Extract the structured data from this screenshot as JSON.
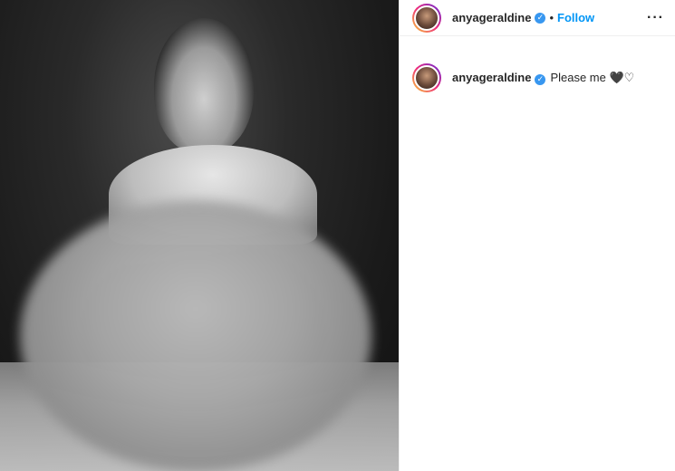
{
  "post": {
    "username": "anyageraldine",
    "follow_label": "Follow",
    "separator": "•",
    "more_label": "···",
    "verified_glyph": "✓",
    "caption": "Please me 🖤♡"
  },
  "icons": {
    "verified": "verified-badge-icon",
    "more": "more-options-icon"
  },
  "colors": {
    "follow": "#0095f6",
    "verified": "#3897f0"
  }
}
